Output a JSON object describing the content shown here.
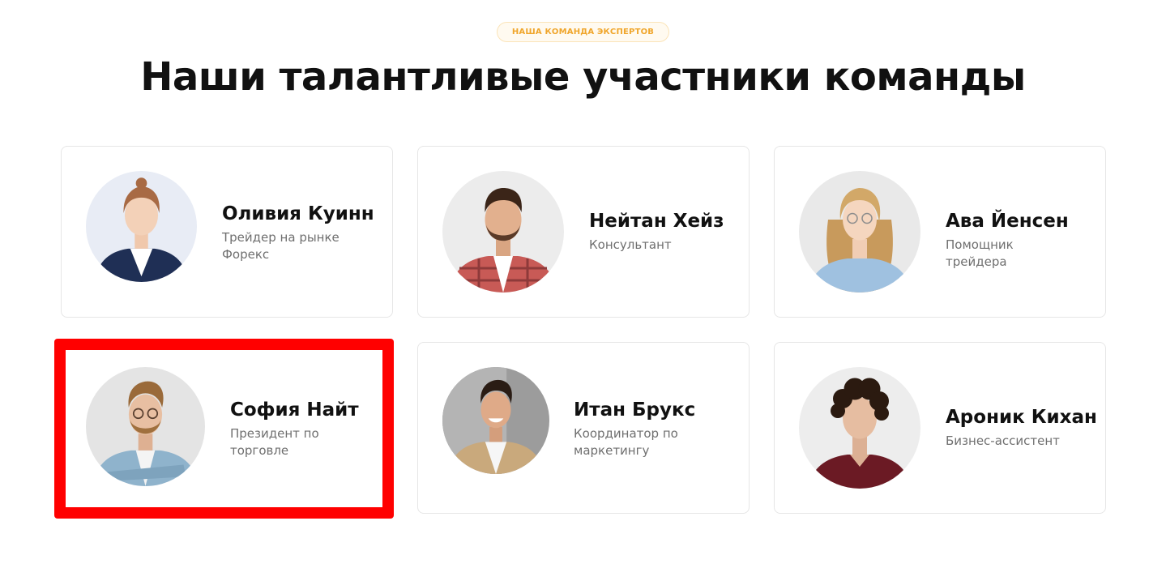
{
  "header": {
    "badge": "НАША КОМАНДА ЭКСПЕРТОВ",
    "title": "Наши талантливые участники команды"
  },
  "team": [
    {
      "name": "Оливия Куинн",
      "role": "Трейдер на рынке Форекс",
      "photo": "woman-navy-blazer-photo"
    },
    {
      "name": "Нейтан Хейз",
      "role": "Консультант",
      "photo": "bearded-man-plaid-shirt-photo"
    },
    {
      "name": "Ава Йенсен",
      "role": "Помощник трейдера",
      "photo": "woman-glasses-denim-shirt-photo"
    },
    {
      "name": "София Найт",
      "role": "Президент по торговле",
      "photo": "man-glasses-denim-shirt-photo"
    },
    {
      "name": "Итан Брукс",
      "role": "Координатор по маркетингу",
      "photo": "smiling-man-beige-jacket-photo"
    },
    {
      "name": "Ароник Кихан",
      "role": "Бизнес-ассистент",
      "photo": "curly-hair-man-burgundy-photo"
    }
  ],
  "colors": {
    "accent": "#f0a62c",
    "highlight": "#ff0000",
    "card_border": "#e6e6e6",
    "role_text": "#6f6f6f"
  }
}
